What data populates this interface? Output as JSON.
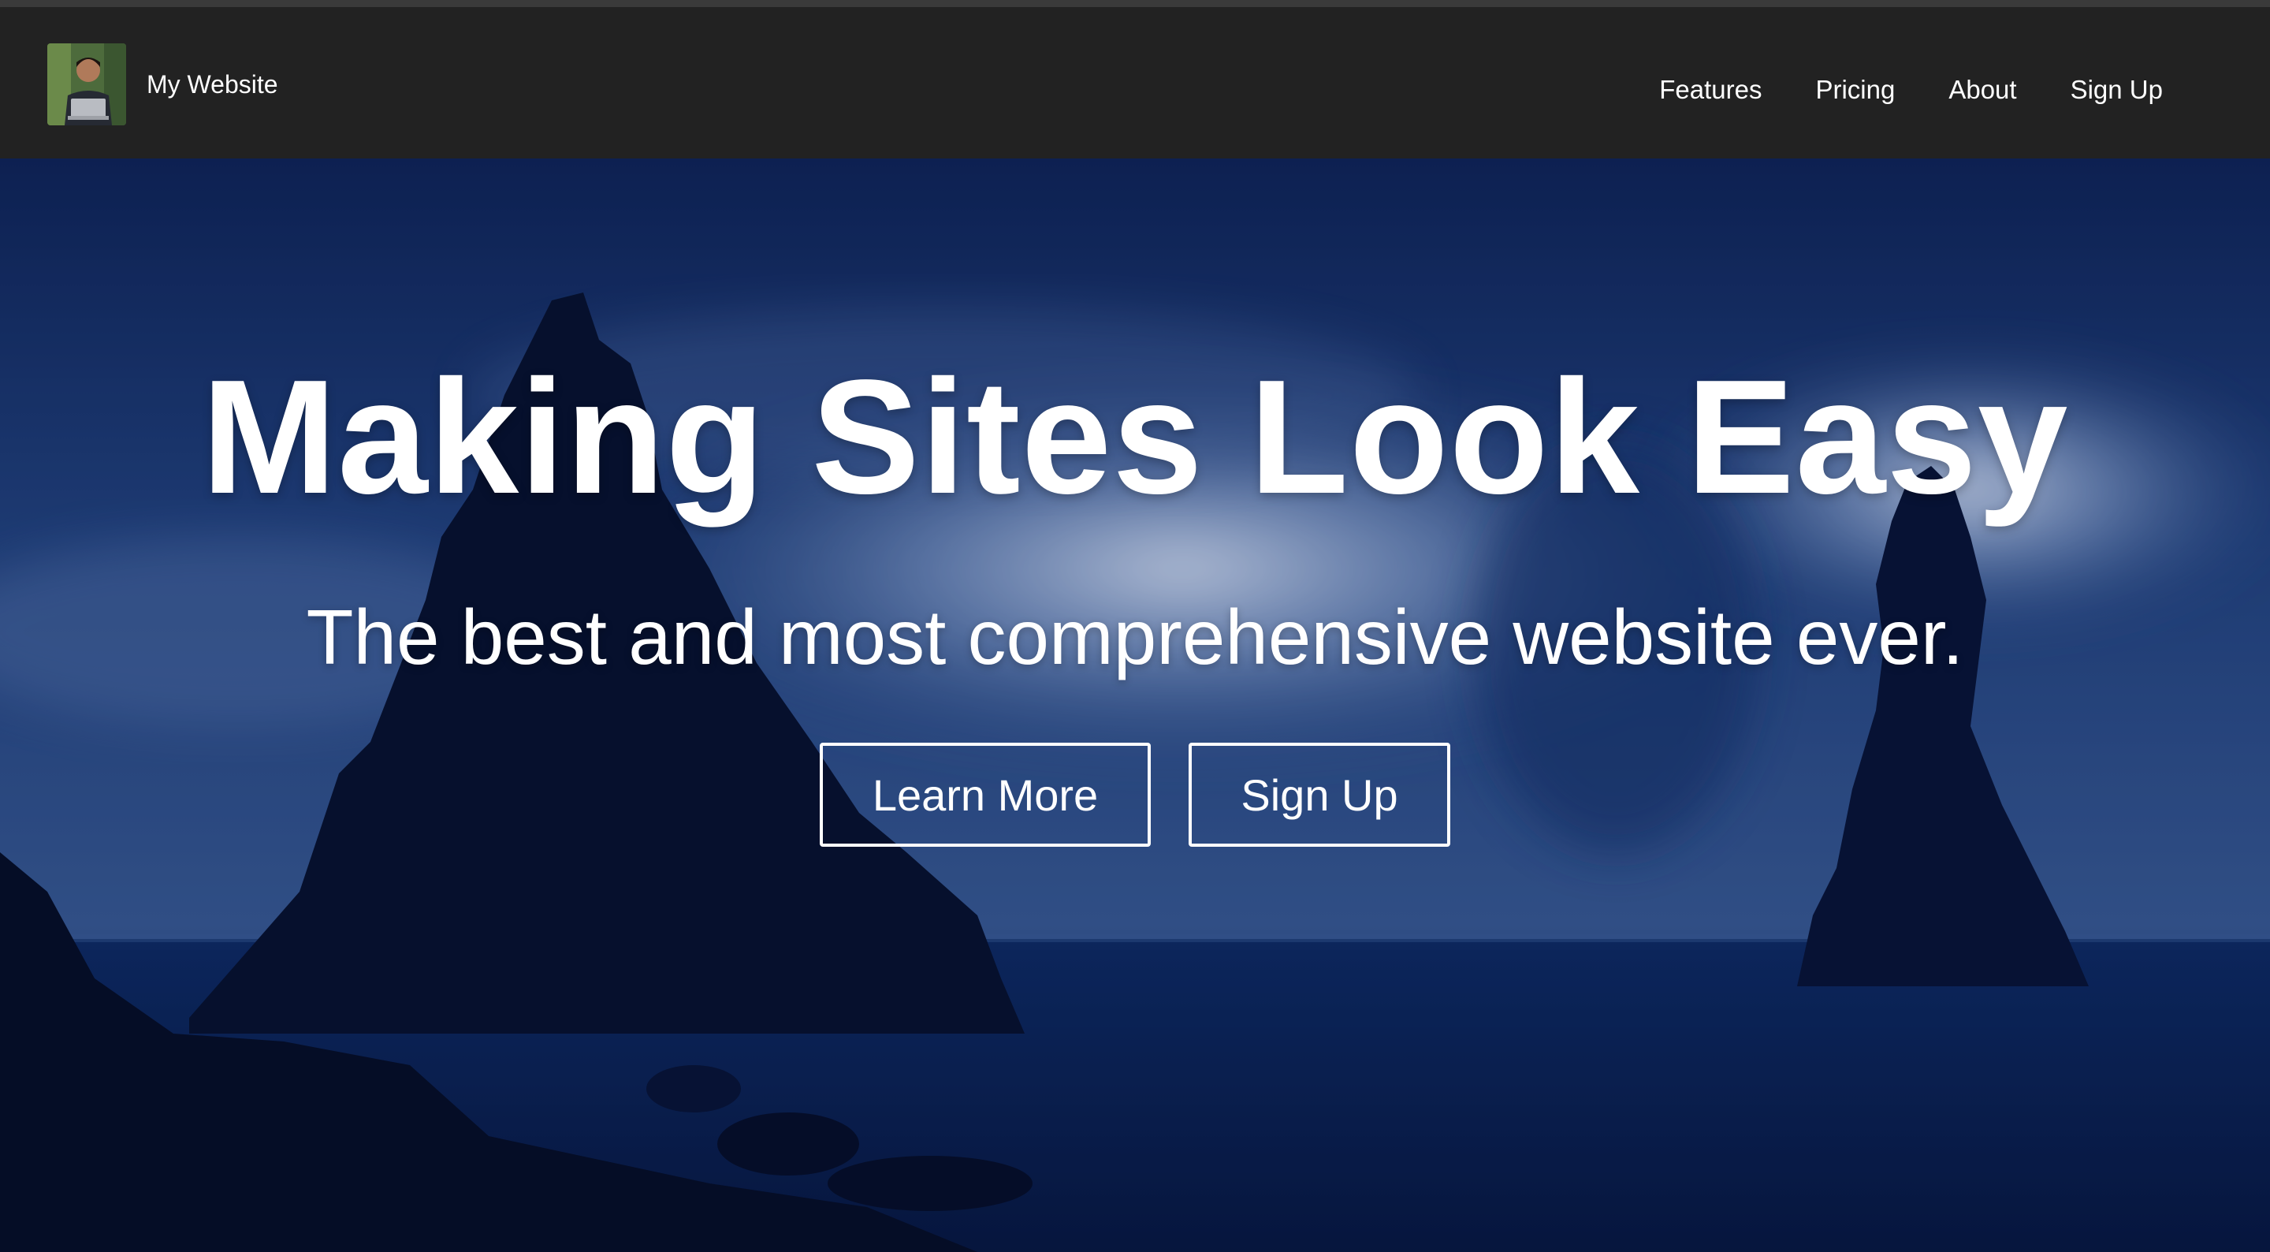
{
  "navbar": {
    "brand_name": "My Website",
    "avatar_icon": "user-avatar",
    "links": [
      {
        "label": "Features"
      },
      {
        "label": "Pricing"
      },
      {
        "label": "About"
      },
      {
        "label": "Sign Up"
      }
    ]
  },
  "hero": {
    "title": "Making Sites Look Easy",
    "subtitle": "The best and most comprehensive website ever.",
    "buttons": [
      {
        "label": "Learn More"
      },
      {
        "label": "Sign Up"
      }
    ]
  },
  "colors": {
    "navbar_bg": "#222222",
    "text": "#ffffff",
    "hero_sky": "#1b3a78",
    "hero_rock": "#070f2a",
    "hero_sea": "#0c2257"
  }
}
